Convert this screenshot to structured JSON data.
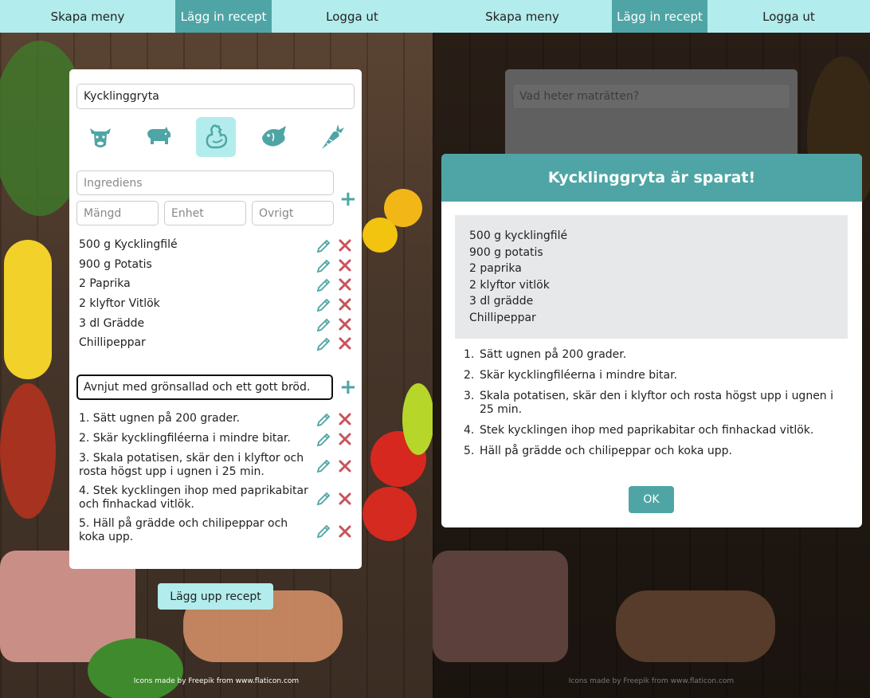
{
  "nav": {
    "items": [
      {
        "label": "Skapa meny"
      },
      {
        "label": "Lägg in recept"
      },
      {
        "label": "Logga ut"
      }
    ],
    "active_index": 1
  },
  "form": {
    "dish_name": "Kycklinggryta",
    "dish_placeholder": "Vad heter maträtten?",
    "categories": [
      {
        "icon": "cow-icon",
        "active": false
      },
      {
        "icon": "pig-icon",
        "active": false
      },
      {
        "icon": "chicken-icon",
        "active": true
      },
      {
        "icon": "fish-icon",
        "active": false
      },
      {
        "icon": "carrot-icon",
        "active": false
      }
    ],
    "ingredient_placeholder": "Ingrediens",
    "amount_placeholder": "Mängd",
    "unit_placeholder": "Enhet",
    "other_placeholder": "Övrigt",
    "ingredients": [
      "500 g Kycklingfilé",
      "900 g Potatis",
      "2 Paprika",
      "2 klyftor Vitlök",
      "3 dl Grädde",
      "Chillipeppar"
    ],
    "step_input": "Avnjut med grönsallad och ett gott bröd.",
    "steps": [
      "1. Sätt ugnen på 200 grader.",
      "2. Skär kycklingfiléerna i mindre bitar.",
      "3. Skala potatisen, skär den i klyftor och rosta högst upp i ugnen i 25 min.",
      "4. Stek kycklingen ihop med paprikabitar och finhackad vitlök.",
      "5. Häll på grädde och chilipeppar och koka upp."
    ],
    "submit_label": "Lägg upp recept"
  },
  "footer": "Icons made by Freepik from www.flaticon.com",
  "modal": {
    "title": "Kycklinggryta är sparat!",
    "ingredients": [
      "500 g kycklingfilé",
      "900 g potatis",
      "2 paprika",
      "2 klyftor vitlök",
      "3 dl grädde",
      "Chillipeppar"
    ],
    "steps": [
      {
        "n": "1.",
        "text": "Sätt ugnen på 200 grader."
      },
      {
        "n": "2.",
        "text": "Skär kycklingfiléerna i mindre bitar."
      },
      {
        "n": "3.",
        "text": "Skala potatisen, skär den i klyftor och rosta högst upp i ugnen i 25 min."
      },
      {
        "n": "4.",
        "text": "Stek kycklingen ihop med paprikabitar och finhackad vitlök."
      },
      {
        "n": "5.",
        "text": "Häll på grädde och chilipeppar och koka upp."
      }
    ],
    "ok_label": "OK"
  },
  "colors": {
    "nav_bg": "#b3ecec",
    "accent": "#4fa5a5",
    "delete": "#c9535a"
  }
}
